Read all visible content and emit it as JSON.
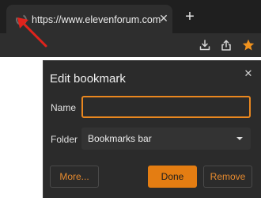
{
  "browser": {
    "tab": {
      "title": "https://www.elevenforum.com",
      "status_icon": "loading-spinner-icon",
      "close_symbol": "✕"
    },
    "new_tab_symbol": "+",
    "toolbar_icons": [
      "download-icon",
      "share-icon",
      "star-icon"
    ],
    "colors": {
      "star": "#f0921e",
      "chrome": "#1f1f1f",
      "toolbar": "#2e2e2e"
    }
  },
  "dialog": {
    "title": "Edit bookmark",
    "close_symbol": "✕",
    "name_label": "Name",
    "name_value": "",
    "folder_label": "Folder",
    "folder_value": "Bookmarks bar",
    "buttons": {
      "more": "More...",
      "done": "Done",
      "remove": "Remove"
    },
    "colors": {
      "accent": "#e47d12",
      "background": "#2b2b2b"
    }
  },
  "annotation": {
    "arrow_color": "#e0231c"
  }
}
